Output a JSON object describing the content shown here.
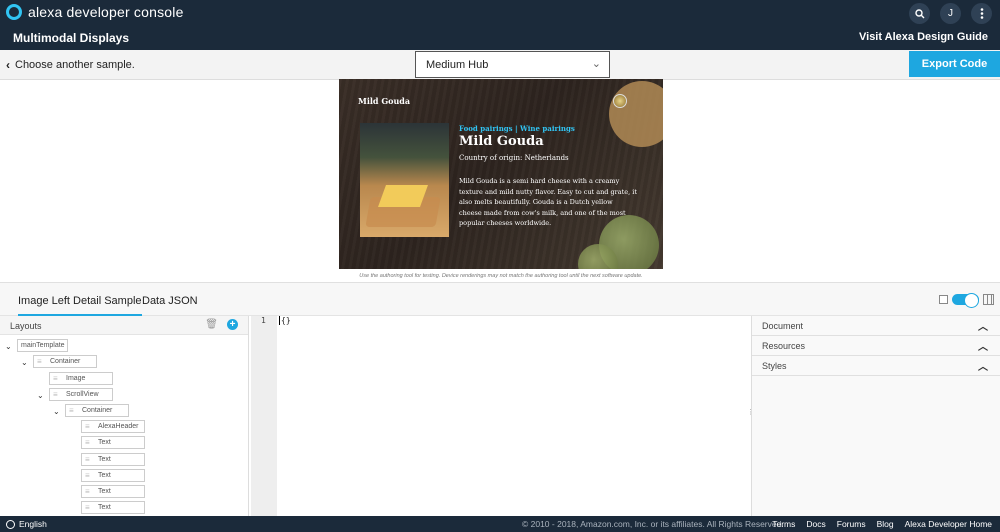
{
  "header": {
    "brand": "alexa developer console",
    "section": "Multimodal Displays",
    "design_guide_link": "Visit Alexa Design Guide",
    "user_initial": "J",
    "colors": {
      "bar": "#1b2a3a",
      "accent": "#1ea7e0",
      "alexa_ring": "#31c4f3"
    }
  },
  "toolbar": {
    "back_label": "Choose another sample.",
    "device_selected": "Medium Hub",
    "export_label": "Export Code"
  },
  "device_preview": {
    "header_title": "Mild Gouda",
    "category": "Food pairings | Wine pairings",
    "title": "Mild Gouda",
    "origin": "Country of origin: Netherlands",
    "description": "Mild Gouda is a semi hard cheese with a creamy texture and mild nutty flavor. Easy to cut and grate, it also melts beautifully. Gouda is a Dutch yellow cheese made from cow's milk, and one of the most popular cheeses worldwide.",
    "disclaimer": "Use the authoring tool for testing. Device renderings may not match the authoring tool until the next software update."
  },
  "tabs": [
    {
      "label": "Image Left Detail Sample",
      "active": true
    },
    {
      "label": "Data JSON",
      "active": false
    }
  ],
  "layouts_panel": {
    "title": "Layouts",
    "tree": [
      {
        "label": "mainTemplate"
      },
      {
        "label": "Container"
      },
      {
        "label": "Image"
      },
      {
        "label": "ScrollView"
      },
      {
        "label": "Container"
      },
      {
        "label": "AlexaHeader"
      },
      {
        "label": "Text"
      },
      {
        "label": "Text"
      },
      {
        "label": "Text"
      },
      {
        "label": "Text"
      },
      {
        "label": "Text"
      }
    ]
  },
  "editor": {
    "line_number": "1",
    "content": "{}"
  },
  "side_panel": {
    "sections": [
      "Document",
      "Resources",
      "Styles"
    ]
  },
  "footer": {
    "language": "English",
    "copyright": "© 2010 - 2018, Amazon.com, Inc. or its affiliates. All Rights Reserved.",
    "links": [
      "Terms",
      "Docs",
      "Forums",
      "Blog",
      "Alexa Developer Home"
    ]
  }
}
